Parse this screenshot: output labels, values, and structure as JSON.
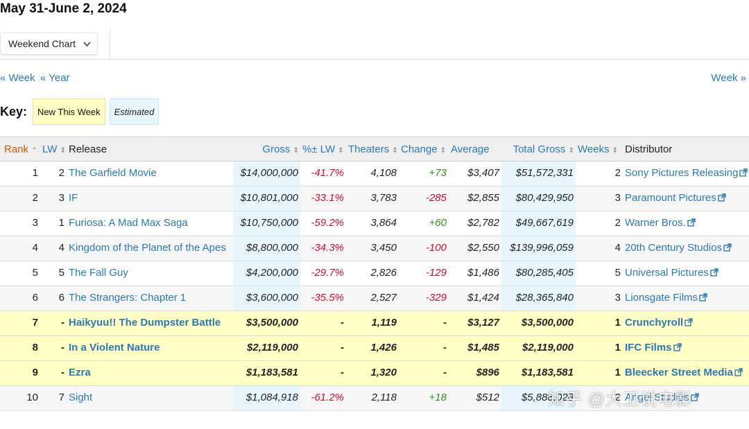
{
  "header": {
    "date_title": "May 31-June 2, 2024",
    "chart_select": "Weekend Chart"
  },
  "nav": {
    "prev_week": "« Week",
    "prev_year": "« Year",
    "next_week": "Week »"
  },
  "key": {
    "label": "Key:",
    "new_this_week": "New This Week",
    "estimated": "Estimated"
  },
  "columns": [
    "Rank",
    "LW",
    "Release",
    "Gross",
    "%± LW",
    "Theaters",
    "Change",
    "Average",
    "Total Gross",
    "Weeks",
    "Distributor"
  ],
  "rows": [
    {
      "rank": "1",
      "lw": "2",
      "release": "The Garfield Movie",
      "gross": "$14,000,000",
      "pct_lw": "-41.7%",
      "theaters": "4,108",
      "change": "+73",
      "average": "$3,407",
      "total_gross": "$51,572,331",
      "weeks": "2",
      "distributor": "Sony Pictures Releasing"
    },
    {
      "rank": "2",
      "lw": "3",
      "release": "IF",
      "gross": "$10,801,000",
      "pct_lw": "-33.1%",
      "theaters": "3,783",
      "change": "-285",
      "average": "$2,855",
      "total_gross": "$80,429,950",
      "weeks": "3",
      "distributor": "Paramount Pictures"
    },
    {
      "rank": "3",
      "lw": "1",
      "release": "Furiosa: A Mad Max Saga",
      "gross": "$10,750,000",
      "pct_lw": "-59.2%",
      "theaters": "3,864",
      "change": "+60",
      "average": "$2,782",
      "total_gross": "$49,667,619",
      "weeks": "2",
      "distributor": "Warner Bros."
    },
    {
      "rank": "4",
      "lw": "4",
      "release": "Kingdom of the Planet of the Apes",
      "gross": "$8,800,000",
      "pct_lw": "-34.3%",
      "theaters": "3,450",
      "change": "-100",
      "average": "$2,550",
      "total_gross": "$139,996,059",
      "weeks": "4",
      "distributor": "20th Century Studios"
    },
    {
      "rank": "5",
      "lw": "5",
      "release": "The Fall Guy",
      "gross": "$4,200,000",
      "pct_lw": "-29.7%",
      "theaters": "2,826",
      "change": "-129",
      "average": "$1,486",
      "total_gross": "$80,285,405",
      "weeks": "5",
      "distributor": "Universal Pictures"
    },
    {
      "rank": "6",
      "lw": "6",
      "release": "The Strangers: Chapter 1",
      "gross": "$3,600,000",
      "pct_lw": "-35.5%",
      "theaters": "2,527",
      "change": "-329",
      "average": "$1,424",
      "total_gross": "$28,365,840",
      "weeks": "3",
      "distributor": "Lionsgate Films"
    },
    {
      "rank": "7",
      "lw": "-",
      "release": "Haikyuu!! The Dumpster Battle",
      "gross": "$3,500,000",
      "pct_lw": "-",
      "theaters": "1,119",
      "change": "-",
      "average": "$3,127",
      "total_gross": "$3,500,000",
      "weeks": "1",
      "distributor": "Crunchyroll"
    },
    {
      "rank": "8",
      "lw": "-",
      "release": "In a Violent Nature",
      "gross": "$2,119,000",
      "pct_lw": "-",
      "theaters": "1,426",
      "change": "-",
      "average": "$1,485",
      "total_gross": "$2,119,000",
      "weeks": "1",
      "distributor": "IFC Films"
    },
    {
      "rank": "9",
      "lw": "-",
      "release": "Ezra",
      "gross": "$1,183,581",
      "pct_lw": "-",
      "theaters": "1,320",
      "change": "-",
      "average": "$896",
      "total_gross": "$1,183,581",
      "weeks": "1",
      "distributor": "Bleecker Street Media"
    },
    {
      "rank": "10",
      "lw": "7",
      "release": "Sight",
      "gross": "$1,084,918",
      "pct_lw": "-61.2%",
      "theaters": "2,118",
      "change": "+18",
      "average": "$512",
      "total_gross": "$5,888,028",
      "weeks": "2",
      "distributor": "Angel Studios"
    }
  ],
  "watermark": "知乎 @大卫说电影",
  "colors": {
    "link": "#2a7ab0",
    "rank_header": "#c45a00",
    "negative": "#c8102e",
    "positive": "#3c8a1e",
    "new_this_week_bg": "#ffffc6",
    "estimated_bg": "#e6f6fc"
  },
  "icons": {
    "chart_select": "chevron-down-icon",
    "sort": "sort-arrows-icon",
    "distributor": "external-link-icon"
  }
}
